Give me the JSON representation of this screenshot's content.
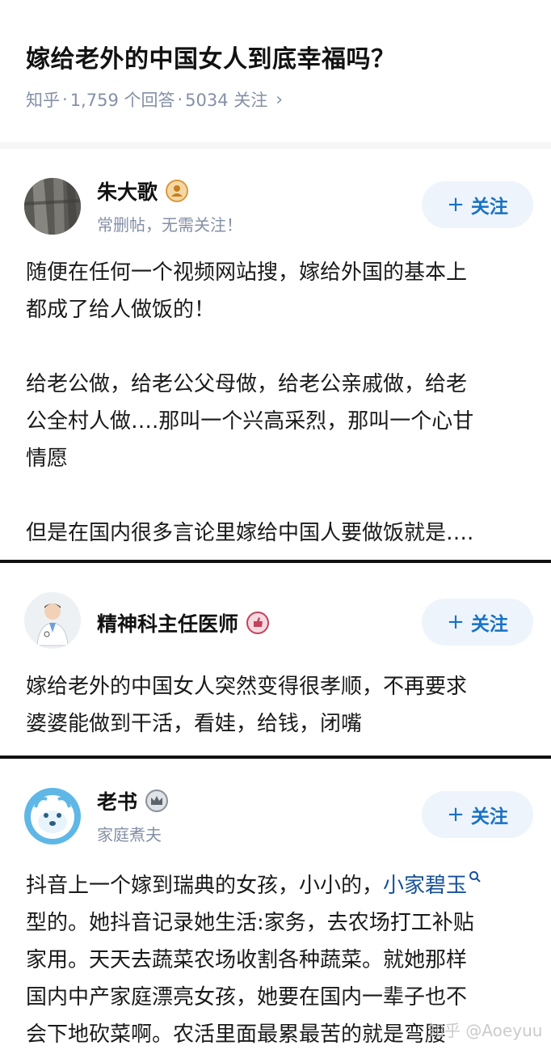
{
  "question": {
    "title": "嫁给老外的中国女人到底幸福吗？",
    "source": "知乎",
    "answers_count": "1,759 个回答",
    "followers_count": "5034 关注",
    "separator": "·"
  },
  "answers": [
    {
      "author": "朱大歌",
      "bio": "常删帖，无需关注！",
      "follow_label": "关注",
      "paragraphs": [
        "随便在任何一个视频网站搜，嫁给外国的基本上",
        "都成了给人做饭的！",
        "",
        "给老公做，给老公父母做，给老公亲戚做，给老",
        "公全村人做….那叫一个兴高采烈，那叫一个心甘",
        "情愿",
        "",
        "但是在国内很多言论里嫁给中国人要做饭就是…."
      ]
    },
    {
      "author": "精神科主任医师",
      "follow_label": "关注",
      "paragraphs": [
        "嫁给老外的中国女人突然变得很孝顺，不再要求",
        "婆婆能做到干活，看娃，给钱，闭嘴"
      ]
    },
    {
      "author": "老书",
      "bio": "家庭煮夫",
      "follow_label": "关注",
      "line1_prefix": "抖音上一个嫁到瑞典的女孩，小小的，",
      "line1_link": "小家碧玉",
      "paragraphs": [
        "型的。她抖音记录她生活:家务，去农场打工补贴",
        "家用。天天去蔬菜农场收割各种蔬菜。就她那样",
        "国内中产家庭漂亮女孩，她要在国内一辈子也不",
        "会下地砍菜啊。农活里面最累最苦的就是弯腰"
      ]
    }
  ],
  "watermark": "知乎 @Aoeyuu",
  "colors": {
    "accent_blue": "#1772c4",
    "follow_bg": "#eef4fb",
    "meta_gray": "#8590a6",
    "link_blue": "#175199"
  }
}
